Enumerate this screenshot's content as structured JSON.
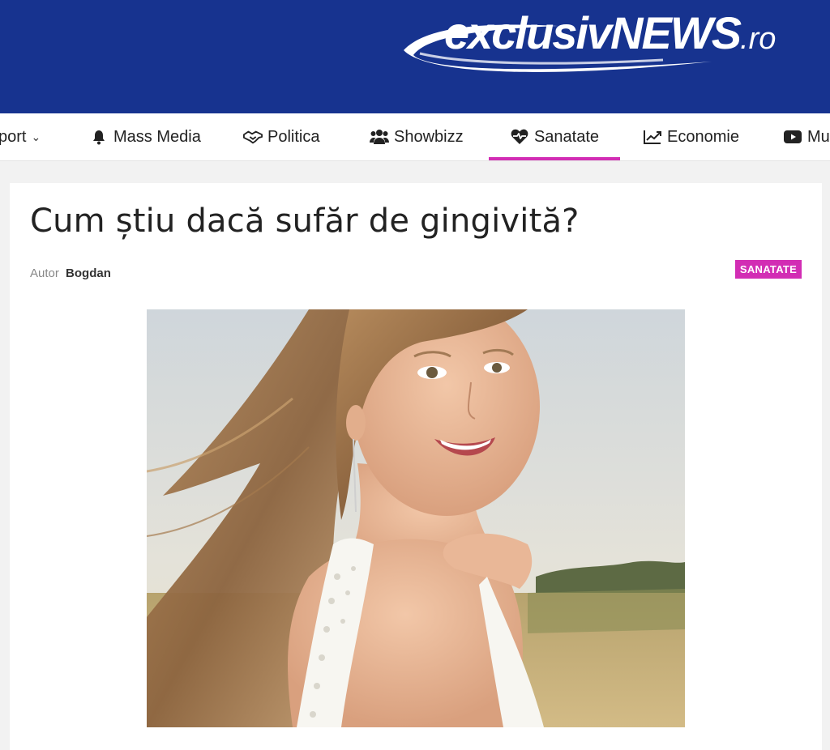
{
  "header": {
    "logo_main": "exclusivNEWS",
    "logo_suffix": ".ro",
    "background_color": "#17338f"
  },
  "nav": {
    "items": [
      {
        "label": "port",
        "icon": "chevron-down-icon"
      },
      {
        "label": "Mass Media",
        "icon": "bell-icon"
      },
      {
        "label": "Politica",
        "icon": "handshake-icon"
      },
      {
        "label": "Showbizz",
        "icon": "users-icon"
      },
      {
        "label": "Sanatate",
        "icon": "heartbeat-icon",
        "active": true
      },
      {
        "label": "Economie",
        "icon": "chart-line-icon"
      },
      {
        "label": "Mu",
        "icon": "youtube-icon"
      }
    ],
    "active_color": "#d22db4"
  },
  "article": {
    "title": "Cum știu dacă sufăr de gingivită?",
    "author_prefix": "Autor",
    "author": "Bogdan",
    "category": "SANATATE",
    "category_color": "#d22db4",
    "image_alt": "Smiling young woman with long hair in a field"
  }
}
